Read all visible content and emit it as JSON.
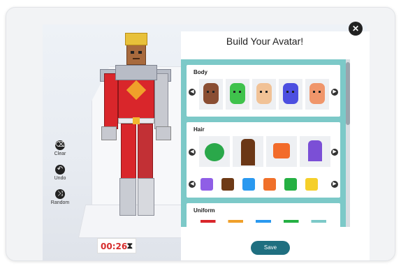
{
  "panel": {
    "title": "Build Your Avatar!",
    "close_icon": "close-icon"
  },
  "sections": {
    "body": {
      "title": "Body",
      "skin_colors": [
        "#8a4e33",
        "#3fc24c",
        "#f1c296",
        "#4c4fe0",
        "#f0966b"
      ]
    },
    "hair": {
      "title": "Hair",
      "style_colors": [
        "#2aa84a",
        "#6b3716",
        "#f26b2a",
        "#7b4fd6"
      ],
      "color_swatches": [
        "#8f5ee6",
        "#6e3a16",
        "#2a99f0",
        "#f0702a",
        "#25b043",
        "#f5cf2a"
      ]
    },
    "uniform": {
      "title": "Uniform"
    }
  },
  "tools": {
    "clear": "Clear",
    "undo": "Undo",
    "random": "Random"
  },
  "timer": {
    "value": "00:26"
  },
  "footer": {
    "save_label": "Save"
  },
  "colors": {
    "accent": "#1f6f80",
    "panel_bg": "#7cc9c8",
    "timer_text": "#d62d2d"
  }
}
